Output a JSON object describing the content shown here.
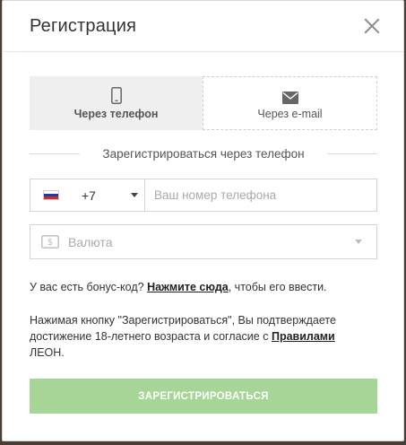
{
  "modal": {
    "title": "Регистрация"
  },
  "tabs": [
    {
      "label": "Через телефон",
      "icon": "phone-icon",
      "active": true
    },
    {
      "label": "Через e-mail",
      "icon": "envelope-icon",
      "active": false
    }
  ],
  "divider_text": "Зарегистрироваться через телефон",
  "phone": {
    "country_code": "+7",
    "placeholder": "Ваш номер телефона",
    "flag_colors": [
      "#ffffff",
      "#1c3fa3",
      "#d52b1e"
    ]
  },
  "currency": {
    "placeholder": "Валюта"
  },
  "bonus": {
    "prefix": "У вас есть бонус-код?",
    "link": "Нажмите сюда",
    "suffix": ", чтобы его ввести."
  },
  "agreement": {
    "prefix": "Нажимая кнопку \"Зарегистрироваться\", Вы подтверждаете достижение 18-летнего возраста и согласие с",
    "link": "Правилами",
    "suffix": "ЛЕОН."
  },
  "submit_label": "ЗАРЕГИСТРИРОВАТЬСЯ",
  "colors": {
    "submit_bg": "#a7d598",
    "active_tab_bg": "#efefef"
  }
}
